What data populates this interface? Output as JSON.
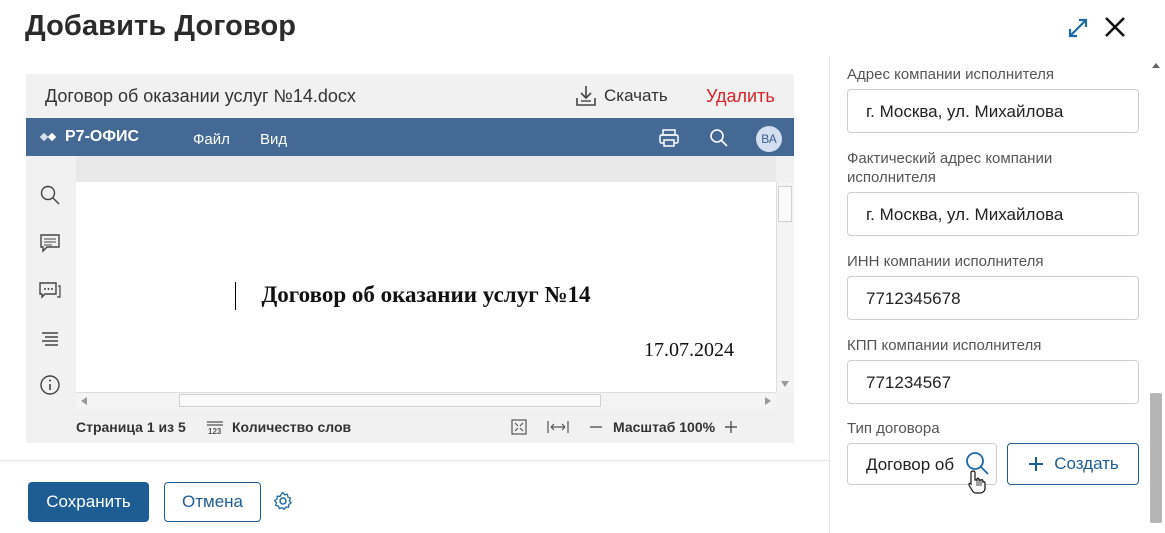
{
  "dialog": {
    "title": "Добавить Договор"
  },
  "viewer": {
    "file_name": "Договор об оказании услуг №14.docx",
    "download_label": "Скачать",
    "delete_label": "Удалить",
    "editor": {
      "logo_text": "Р7-ОФИС",
      "menu": [
        "Файл",
        "Вид"
      ],
      "avatar_initials": "ВА"
    },
    "document": {
      "title": "Договор об оказании услуг №14",
      "date": "17.07.2024"
    },
    "status": {
      "page": "Страница 1 из 5",
      "word_count": "Количество слов",
      "zoom": "Масштаб 100%"
    }
  },
  "form": {
    "fields": [
      {
        "label": "Адрес компании исполнителя",
        "value": "г. Москва, ул. Михайлова"
      },
      {
        "label": "Фактический адрес компании исполнителя",
        "value": "г. Москва, ул. Михайлова"
      },
      {
        "label": "ИНН компании исполнителя",
        "value": "7712345678"
      },
      {
        "label": "КПП компании исполнителя",
        "value": "771234567"
      }
    ],
    "contract_type": {
      "label": "Тип договора",
      "value": "Договор об",
      "create_label": "Создать"
    }
  },
  "footer": {
    "save_label": "Сохранить",
    "cancel_label": "Отмена"
  },
  "colors": {
    "primary": "#1e5c94",
    "editor_bar": "#446995",
    "danger": "#d8232a"
  }
}
